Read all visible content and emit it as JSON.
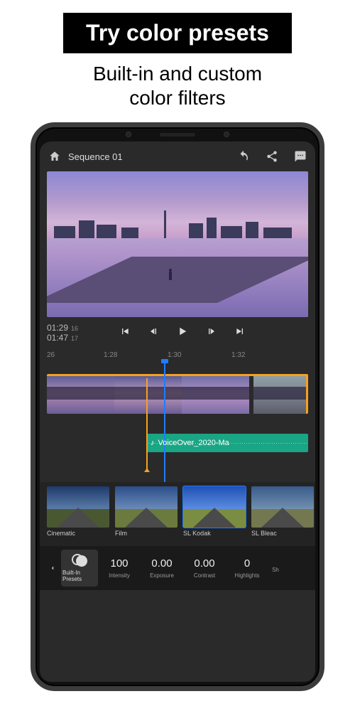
{
  "promo": {
    "banner": "Try color presets",
    "subtitle_l1": "Built-in and custom",
    "subtitle_l2": "color filters"
  },
  "topbar": {
    "sequence_title": "Sequence 01"
  },
  "playbar": {
    "tc_in": "01:29",
    "tc_in_f": "16",
    "tc_out": "01:47",
    "tc_out_f": "17"
  },
  "ruler": {
    "t0": "26",
    "t1": "1:28",
    "t2": "1:30",
    "t3": "1:32"
  },
  "audio": {
    "clip_label": "VoiceOver_2020-Ma"
  },
  "presets": {
    "items": [
      {
        "label": "Cinematic"
      },
      {
        "label": "Film"
      },
      {
        "label": "SL Kodak"
      },
      {
        "label": "SL Bleac"
      }
    ],
    "selected_index": 2
  },
  "params": {
    "builtin_label": "Built-In Presets",
    "items": [
      {
        "value": "100",
        "label": "Intensity"
      },
      {
        "value": "0.00",
        "label": "Exposure"
      },
      {
        "value": "0.00",
        "label": "Contrast"
      },
      {
        "value": "0",
        "label": "Highlights"
      },
      {
        "value": "",
        "label": "Sh"
      }
    ]
  }
}
